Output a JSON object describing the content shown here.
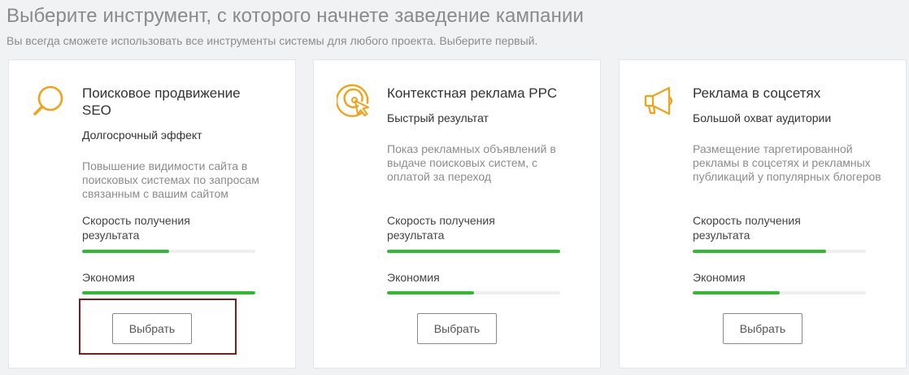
{
  "header": {
    "title": "Выберите инструмент, с которого начнете заведение кампании",
    "subtitle": "Вы всегда сможете использовать все инструменты системы для любого проекта. Выберите первый."
  },
  "colors": {
    "accent_icon": "#f0a318",
    "progress": "#2fbb2f",
    "track": "#eeeeee",
    "highlight": "#7a1f1f"
  },
  "cards": [
    {
      "icon": "magnifier-icon",
      "title": "Поисковое продвижение SEO",
      "tagline": "Долгосрочный эффект",
      "description": "Повышение видимости сайта в поисковых системах по запросам связанным с вашим сайтом",
      "speed_label": "Скорость получения результата",
      "speed_level": 0.5,
      "economy_label": "Экономия",
      "economy_level": 1.0,
      "button_label": "Выбрать",
      "highlighted": true
    },
    {
      "icon": "target-cursor-icon",
      "title": "Контекстная реклама PPC",
      "tagline": "Быстрый результат",
      "description": "Показ рекламных объявлений в выдаче поисковых систем, с оплатой за переход",
      "speed_label": "Скорость получения результата",
      "speed_level": 1.0,
      "economy_label": "Экономия",
      "economy_level": 0.5,
      "button_label": "Выбрать",
      "highlighted": false
    },
    {
      "icon": "megaphone-icon",
      "title": "Реклама в соцсетях",
      "tagline": "Большой охват аудитории",
      "description": "Размещение таргетированной рекламы в соцсетях и рекламных публикаций у популярных блогеров",
      "speed_label": "Скорость получения результата",
      "speed_level": 0.77,
      "economy_label": "Экономия",
      "economy_level": 0.5,
      "button_label": "Выбрать",
      "highlighted": false
    }
  ]
}
